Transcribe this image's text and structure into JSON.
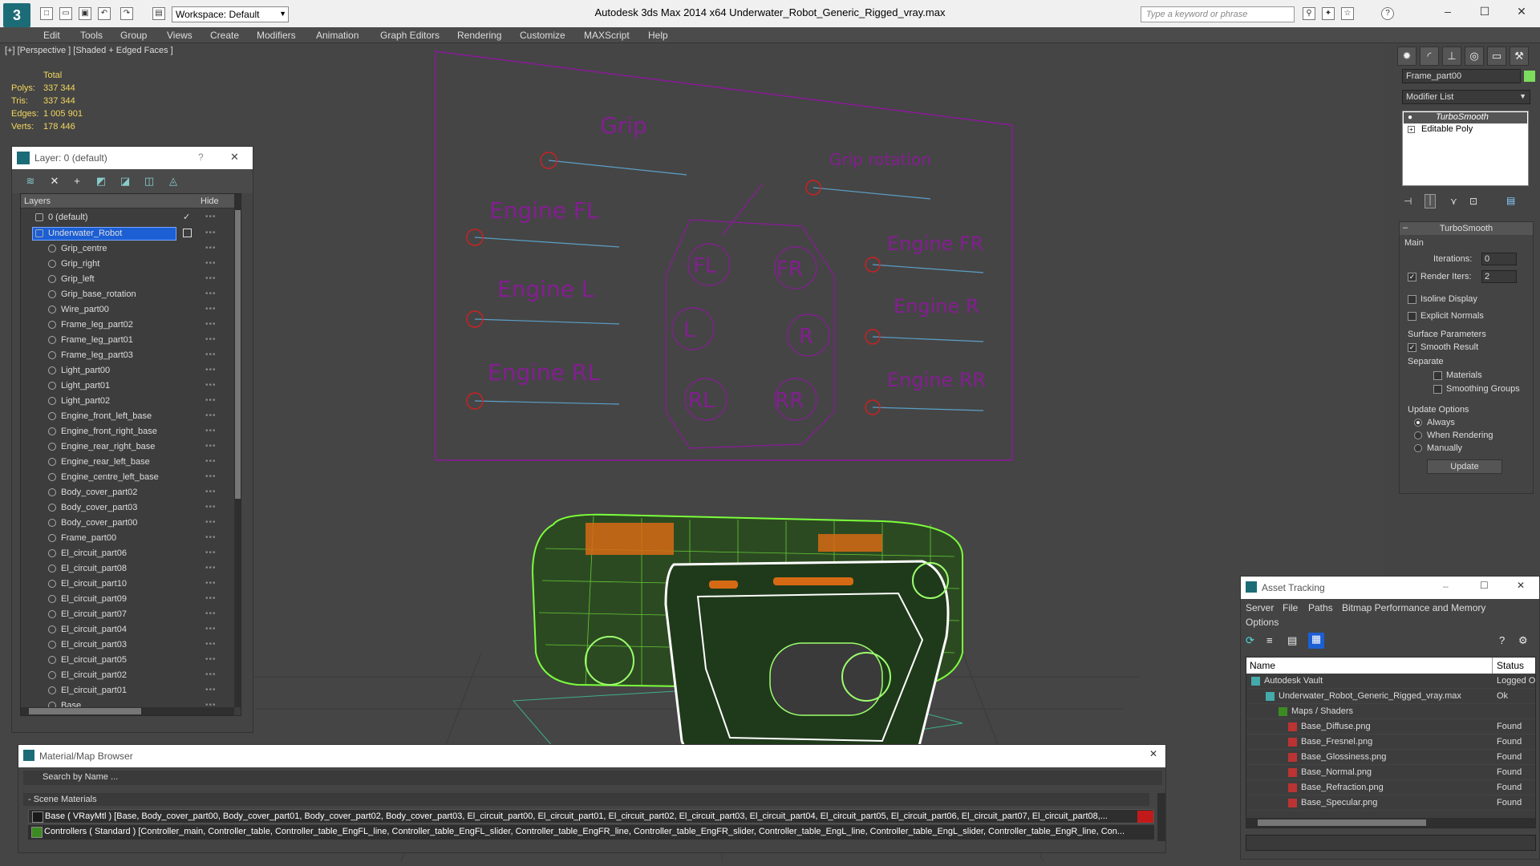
{
  "titlebar": {
    "title": "Autodesk 3ds Max  2014 x64     Underwater_Robot_Generic_Rigged_vray.max",
    "workspace": "Workspace: Default",
    "search_placeholder": "Type a keyword or phrase"
  },
  "menu": [
    "Edit",
    "Tools",
    "Group",
    "Views",
    "Create",
    "Modifiers",
    "Animation",
    "Graph Editors",
    "Rendering",
    "Customize",
    "MAXScript",
    "Help"
  ],
  "viewport": {
    "label": "[+] [Perspective ] [Shaded + Edged Faces ]",
    "stats": {
      "total_label": "Total",
      "rows": [
        {
          "label": "Polys:",
          "value": "337 344"
        },
        {
          "label": "Tris:",
          "value": "337 344"
        },
        {
          "label": "Edges:",
          "value": "1 005 901"
        },
        {
          "label": "Verts:",
          "value": "178 446"
        }
      ]
    },
    "controller_labels": {
      "grip": "Grip",
      "grip_rotation": "Grip rotation",
      "engine_fl": "Engine FL",
      "engine_fr": "Engine FR",
      "engine_l": "Engine L",
      "engine_r": "Engine R",
      "engine_rl": "Engine RL",
      "engine_rr": "Engine RR",
      "fl": "FL",
      "fr": "FR",
      "l": "L",
      "r": "R",
      "rl": "RL",
      "rr": "RR"
    }
  },
  "layer_panel": {
    "title": "Layer: 0 (default)",
    "help": "?",
    "close": "✕",
    "col_layers": "Layers",
    "col_hide": "Hide",
    "layers": [
      "0 (default)",
      "Underwater_Robot"
    ],
    "objects": [
      "Grip_centre",
      "Grip_right",
      "Grip_left",
      "Grip_base_rotation",
      "Wire_part00",
      "Frame_leg_part02",
      "Frame_leg_part01",
      "Frame_leg_part03",
      "Light_part00",
      "Light_part01",
      "Light_part02",
      "Engine_front_left_base",
      "Engine_front_right_base",
      "Engine_rear_right_base",
      "Engine_rear_left_base",
      "Engine_centre_left_base",
      "Body_cover_part02",
      "Body_cover_part03",
      "Body_cover_part00",
      "Frame_part00",
      "El_circuit_part06",
      "El_circuit_part08",
      "El_circuit_part10",
      "El_circuit_part09",
      "El_circuit_part07",
      "El_circuit_part04",
      "El_circuit_part03",
      "El_circuit_part05",
      "El_circuit_part02",
      "El_circuit_part01",
      "Base"
    ]
  },
  "command_panel": {
    "object_name": "Frame_part00",
    "modifier_list": "Modifier List",
    "stack": [
      "TurboSmooth",
      "Editable Poly"
    ],
    "rollout_title": "TurboSmooth",
    "main_label": "Main",
    "iterations_label": "Iterations:",
    "iterations_value": "0",
    "render_iters_label": "Render Iters:",
    "render_iters_value": "2",
    "isoline": "Isoline Display",
    "explicit_normals": "Explicit Normals",
    "surface_params": "Surface Parameters",
    "smooth_result": "Smooth Result",
    "separate": "Separate",
    "materials": "Materials",
    "smoothing_groups": "Smoothing Groups",
    "update_options": "Update Options",
    "always": "Always",
    "when_rendering": "When Rendering",
    "manually": "Manually",
    "update_button": "Update"
  },
  "asset_tracking": {
    "title": "Asset Tracking",
    "menu": [
      "Server",
      "File",
      "Paths",
      "Bitmap Performance and Memory",
      "Options"
    ],
    "col_name": "Name",
    "col_status": "Status",
    "rows": [
      {
        "name": "Autodesk Vault",
        "status": "Logged O"
      },
      {
        "name": "Underwater_Robot_Generic_Rigged_vray.max",
        "status": "Ok"
      },
      {
        "name": "Maps / Shaders",
        "status": ""
      },
      {
        "name": "Base_Diffuse.png",
        "status": "Found"
      },
      {
        "name": "Base_Fresnel.png",
        "status": "Found"
      },
      {
        "name": "Base_Glossiness.png",
        "status": "Found"
      },
      {
        "name": "Base_Normal.png",
        "status": "Found"
      },
      {
        "name": "Base_Refraction.png",
        "status": "Found"
      },
      {
        "name": "Base_Specular.png",
        "status": "Found"
      }
    ]
  },
  "material_browser": {
    "title": "Material/Map Browser",
    "search_placeholder": "Search by Name ...",
    "section": "- Scene Materials",
    "rows": [
      "Base ( VRayMtl ) [Base, Body_cover_part00, Body_cover_part01, Body_cover_part02, Body_cover_part03, El_circuit_part00, El_circuit_part01, El_circuit_part02, El_circuit_part03, El_circuit_part04, El_circuit_part05, El_circuit_part06, El_circuit_part07, El_circuit_part08,...",
      "Controllers ( Standard ) [Controller_main, Controller_table, Controller_table_EngFL_line, Controller_table_EngFL_slider, Controller_table_EngFR_line, Controller_table_EngFR_slider, Controller_table_EngL_line, Controller_table_EngL_slider, Controller_table_EngR_line, Con..."
    ]
  },
  "colors": {
    "controller_purple": "#8b1a9a",
    "wire_green": "#7cff3c",
    "accent_blue": "#1c5fd4"
  }
}
